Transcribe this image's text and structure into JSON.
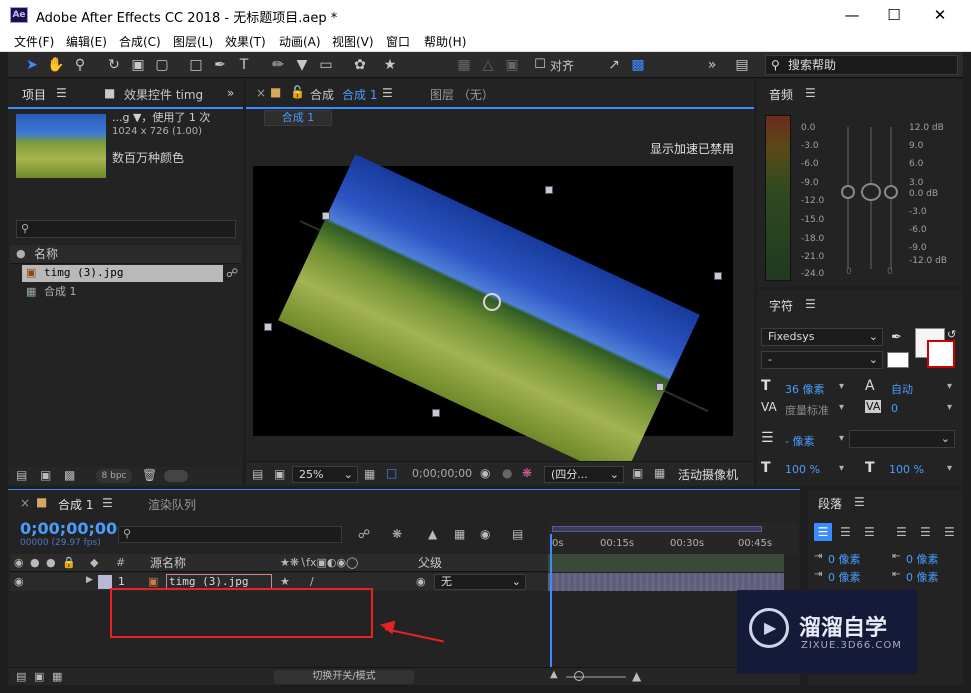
{
  "window": {
    "app_icon": "Ae",
    "title": "Adobe After Effects CC 2018 - 无标题项目.aep *"
  },
  "menu": [
    "文件(F)",
    "编辑(E)",
    "合成(C)",
    "图层(L)",
    "效果(T)",
    "动画(A)",
    "视图(V)",
    "窗口",
    "帮助(H)"
  ],
  "toolbar": {
    "snap_label": "对齐",
    "search_placeholder": "搜索帮助",
    "more": "»"
  },
  "project_panel": {
    "tab_project": "项目",
    "tab_effects": "效果控件 timg",
    "more": "»",
    "asset_name": "...g ▼，使用了 1 次",
    "asset_dims": "1024 x 726 (1.00)",
    "asset_colors": "数百万种颜色",
    "col_name": "名称",
    "items": [
      "timg (3).jpg",
      "合成 1"
    ],
    "bpc": "8 bpc"
  },
  "comp_panel": {
    "tab_comp_prefix": "合成",
    "tab_comp_name": "合成 1",
    "tab_layer": "图层 （无）",
    "comp_crumb": "合成 1",
    "gpu_notice": "显示加速已禁用",
    "zoom": "25%",
    "timecode": "0;00;00;00",
    "resolution": "(四分...",
    "camera": "活动摄像机"
  },
  "audio_panel": {
    "title": "音频",
    "left_scale": [
      "0.0",
      "-3.0",
      "-6.0",
      "-9.0",
      "-12.0",
      "-15.0",
      "-18.0",
      "-21.0",
      "-24.0"
    ],
    "right_scale": [
      "12.0 dB",
      "9.0",
      "6.0",
      "3.0",
      "0.0 dB",
      "-3.0",
      "-6.0",
      "-9.0",
      "-12.0 dB"
    ],
    "zero_left": "0",
    "zero_right": "0"
  },
  "character_panel": {
    "title": "字符",
    "font": "Fixedsys",
    "style": "-",
    "size": "36 像素",
    "leading": "自动",
    "tracking_label": "度量标准",
    "kerning": "0",
    "stroke": "- 像素",
    "vscale": "100 %",
    "hscale": "100 %"
  },
  "timeline_panel": {
    "tab_comp": "合成 1",
    "tab_render": "渲染队列",
    "timecode": "0;00;00;00",
    "fps": "00000 (29.97 fps)",
    "col_num": "#",
    "col_source": "源名称",
    "col_parent": "父级",
    "layer_num": "1",
    "layer_name": "timg (3).jpg",
    "parent_value": "无",
    "ruler": [
      "0s",
      "00:15s",
      "00:30s",
      "00:45s"
    ],
    "toggle_label": "切换开关/模式"
  },
  "paragraph_panel": {
    "title": "段落",
    "indent1": "0 像素",
    "indent2": "0 像素",
    "indent3": "0 像素",
    "indent4": "0 像素"
  },
  "watermark": {
    "brand": "溜溜自学",
    "url": "ZIXUE.3D66.COM"
  },
  "colors": {
    "accent": "#3a8bff",
    "highlight_red": "#e62222",
    "panel_bg": "#232323"
  }
}
